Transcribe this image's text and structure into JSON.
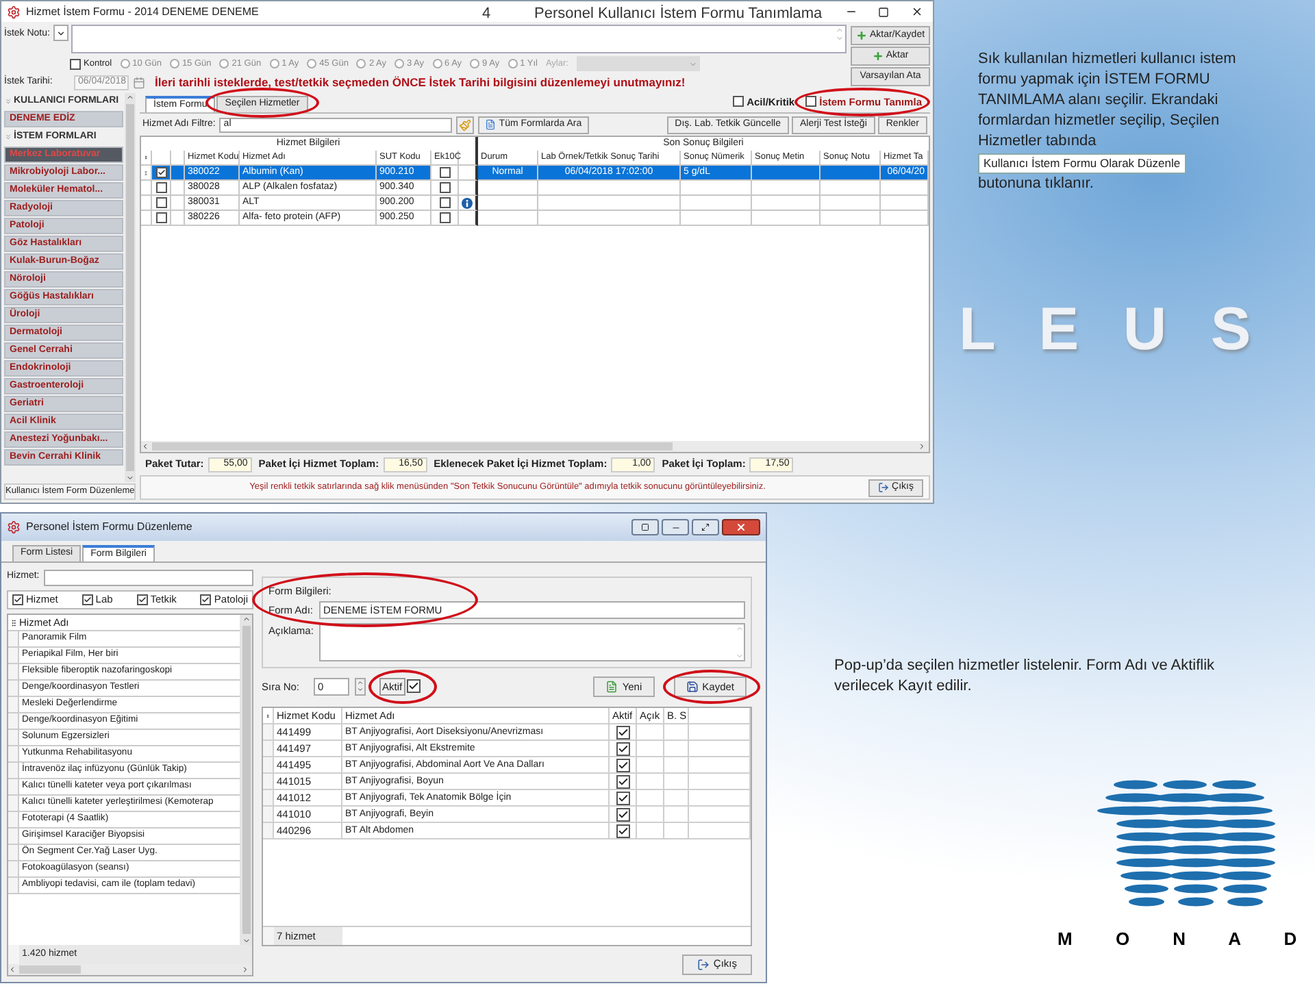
{
  "slide": {
    "number": "4",
    "title": "Personel Kullanıcı İstem Formu Tanımlama"
  },
  "main_window": {
    "title": "Hizmet İstem Formu - 2014 DENEME DENEME",
    "note_label": "İstek Notu:",
    "side_buttons": [
      {
        "label": "Aktar/Kaydet",
        "kind": "add"
      },
      {
        "label": "Aktar",
        "kind": "add"
      },
      {
        "label": "Varsayılan Ata",
        "kind": "plain"
      }
    ],
    "kontrol": {
      "label": "Kontrol",
      "checked": false
    },
    "periods": [
      {
        "label": "10 Gün",
        "selected": false
      },
      {
        "label": "15 Gün",
        "selected": false
      },
      {
        "label": "21 Gün",
        "selected": false
      },
      {
        "label": "1 Ay",
        "selected": false
      },
      {
        "label": "45 Gün",
        "selected": false
      },
      {
        "label": "2 Ay",
        "selected": false
      },
      {
        "label": "3 Ay",
        "selected": false
      },
      {
        "label": "6 Ay",
        "selected": false
      },
      {
        "label": "9 Ay",
        "selected": false
      },
      {
        "label": "1 Yıl",
        "selected": false
      }
    ],
    "months_label": "Aylar:",
    "date": {
      "label": "İstek Tarihi:",
      "value": "06/04/2018",
      "disabled": true
    },
    "warning": "İleri tarihli isteklerde, test/tetkik seçmeden ÖNCE İstek Tarihi bilgisini düzenlemeyi unutmayınız!",
    "sidebar": {
      "sections": [
        {
          "title": "KULLANICI FORMLARI",
          "expanded": true,
          "items": [
            {
              "label": "DENEME EDİZ",
              "selected": false
            }
          ]
        },
        {
          "title": "İSTEM FORMLARI",
          "expanded": true,
          "items": [
            {
              "label": "Merkez Laboratuvar",
              "selected": true
            },
            {
              "label": "Mikrobiyoloji Labor...",
              "selected": false
            },
            {
              "label": "Moleküler Hematol...",
              "selected": false
            },
            {
              "label": "Radyoloji",
              "selected": false
            },
            {
              "label": "Patoloji",
              "selected": false
            },
            {
              "label": "Göz Hastalıkları",
              "selected": false
            },
            {
              "label": "Kulak-Burun-Boğaz",
              "selected": false
            },
            {
              "label": "Nöroloji",
              "selected": false
            },
            {
              "label": "Göğüs Hastalıkları",
              "selected": false
            },
            {
              "label": "Üroloji",
              "selected": false
            },
            {
              "label": "Dermatoloji",
              "selected": false
            },
            {
              "label": "Genel Cerrahi",
              "selected": false
            },
            {
              "label": "Endokrinoloji",
              "selected": false
            },
            {
              "label": "Gastroenteroloji",
              "selected": false
            },
            {
              "label": "Geriatri",
              "selected": false
            },
            {
              "label": "Acil Klinik",
              "selected": false
            },
            {
              "label": "Anestezi Yoğunbakı...",
              "selected": false
            },
            {
              "label": "Bevin Cerrahi Klinik",
              "selected": false
            }
          ]
        }
      ],
      "footer_button": "Kullanıcı İstem Form Düzenleme"
    },
    "tabs": [
      {
        "label": "İstem Formu",
        "selected": true,
        "highlighted": false
      },
      {
        "label": "Seçilen Hizmetler",
        "selected": false,
        "highlighted": true
      }
    ],
    "flags": [
      {
        "label": "Acil/Kritik",
        "checked": false,
        "highlighted": false
      },
      {
        "label": "İstem Formu Tanımla",
        "checked": false,
        "highlighted": true
      }
    ],
    "filter": {
      "label": "Hizmet Adı Filtre:",
      "value": "al"
    },
    "search_all_button": "Tüm Formlarda Ara",
    "right_buttons": [
      "Dış. Lab. Tetkik Güncelle",
      "Alerji Test İsteği",
      "Renkler"
    ],
    "table": {
      "groups": [
        "Hizmet Bilgileri",
        "Son Sonuç Bilgileri"
      ],
      "columns": [
        "Hizmet Kodu",
        "Hizmet Adı",
        "SUT Kodu",
        "Ek10C",
        "Durum",
        "Lab Örnek/Tetkik Sonuç Tarihi",
        "Sonuç Nümerik",
        "Sonuç Metin",
        "Sonuç Notu",
        "Hizmet Ta"
      ],
      "rows": [
        {
          "selected": true,
          "checked": true,
          "info": false,
          "ek10c": false,
          "code": "380022",
          "name": "Albumin (Kan)",
          "sut": "900.210",
          "status": "Normal",
          "date": "06/04/2018 17:02:00",
          "numeric": "5 g/dL",
          "service_date": "06/04/20"
        },
        {
          "selected": false,
          "checked": false,
          "info": false,
          "ek10c": false,
          "code": "380028",
          "name": "ALP (Alkalen fosfataz)",
          "sut": "900.340"
        },
        {
          "selected": false,
          "checked": false,
          "info": true,
          "ek10c": false,
          "code": "380031",
          "name": "ALT",
          "sut": "900.200"
        },
        {
          "selected": false,
          "checked": false,
          "info": false,
          "ek10c": false,
          "code": "380226",
          "name": "Alfa- feto protein (AFP)",
          "sut": "900.250"
        }
      ]
    },
    "totals": [
      {
        "label": "Paket Tutar:",
        "value": "55,00"
      },
      {
        "label": "Paket İçi Hizmet Toplam:",
        "value": "16,50"
      },
      {
        "label": "Eklenecek Paket İçi Hizmet Toplam:",
        "value": "1,00"
      },
      {
        "label": "Paket İçi Toplam:",
        "value": "17,50"
      }
    ],
    "status_text": "Yeşil renkli tetkik satırlarında sağ klik menüsünden \"Son Tetkik Sonucunu Görüntüle\" adımıyla tetkik sonucunu görüntüleyebilirsiniz.",
    "exit_button": "Çıkış"
  },
  "edit_window": {
    "title": "Personel İstem Formu Düzenleme",
    "tabs": [
      {
        "label": "Form Listesi",
        "selected": false
      },
      {
        "label": "Form Bilgileri",
        "selected": true
      }
    ],
    "search_label": "Hizmet:",
    "filters": [
      {
        "label": "Hizmet",
        "checked": true
      },
      {
        "label": "Lab",
        "checked": true
      },
      {
        "label": "Tetkik",
        "checked": true
      },
      {
        "label": "Patoloji",
        "checked": true
      }
    ],
    "list": {
      "header": "Hizmet Adı",
      "items": [
        "Panoramik Film",
        "Periapikal Film, Her biri",
        "Fleksible fiberoptik nazofaringoskopi",
        "Denge/koordinasyon Testleri",
        "Mesleki Değerlendirme",
        "Denge/koordinasyon Eğitimi",
        "Solunum Egzersizleri",
        "Yutkunma Rehabilitasyonu",
        "İntravenöz ilaç infüzyonu (Günlük Takip)",
        "Kalıcı tünelli kateter veya port  çıkarılması",
        "Kalıcı tünelli kateter yerleştirilmesi (Kemoterap",
        "Fototerapi (4 Saatlik)",
        "Girişimsel Karaciğer Biyopsisi",
        "Ön Segment Cer.Yağ Laser Uyg.",
        "Fotokoagülasyon (seansı)",
        "Ambliyopi tedavisi, cam ile (toplam tedavi)"
      ],
      "footer": "1.420 hizmet"
    },
    "form": {
      "group_label": "Form Bilgileri:",
      "highlighted": true,
      "name_label": "Form Adı:",
      "name_value": "DENEME İSTEM FORMU",
      "desc_label": "Açıklama:",
      "order_label": "Sıra No:",
      "order_value": "0",
      "active": {
        "label": "Aktif",
        "checked": true,
        "highlighted": true
      }
    },
    "buttons": [
      {
        "label": "Yeni",
        "kind": "new",
        "highlighted": false
      },
      {
        "label": "Kaydet",
        "kind": "save",
        "highlighted": true
      }
    ],
    "table": {
      "columns": [
        "Hizmet Kodu",
        "Hizmet Adı",
        "Aktif",
        "Açık",
        "B. S"
      ],
      "rows": [
        {
          "code": "441499",
          "name": "BT Anjiyografisi, Aort Diseksiyonu/Anevrizması",
          "active": true
        },
        {
          "code": "441497",
          "name": "BT Anjiyografisi, Alt Ekstremite",
          "active": true
        },
        {
          "code": "441495",
          "name": "BT Anjiyografisi, Abdominal Aort Ve Ana Dalları",
          "active": true
        },
        {
          "code": "441015",
          "name": "BT Anjiyografisi, Boyun",
          "active": true
        },
        {
          "code": "441012",
          "name": "BT Anjiyografi, Tek Anatomik Bölge İçin",
          "active": true
        },
        {
          "code": "441010",
          "name": "BT Anjiyografi, Beyin",
          "active": true
        },
        {
          "code": "440296",
          "name": "BT Alt Abdomen",
          "active": true
        }
      ],
      "footer": "7 hizmet"
    },
    "exit_button": "Çıkış"
  },
  "notes": {
    "top": {
      "text": "Sık kullanılan hizmetleri kullanıcı istem formu yapmak için İSTEM FORMU TANIMLAMA alanı seçilir. Ekrandaki formlardan hizmetler seçilip, Seçilen Hizmetler tabında",
      "button_label": "Kullanıcı İstem Formu Olarak Düzenle",
      "after": "butonuna tıklanır."
    },
    "bottom": "Pop-up’da seçilen hizmetler listelenir. Form Adı ve Aktiflik verilecek Kayıt edilir."
  },
  "logos": {
    "leus": "L E U S",
    "monad": "M O N A D"
  }
}
